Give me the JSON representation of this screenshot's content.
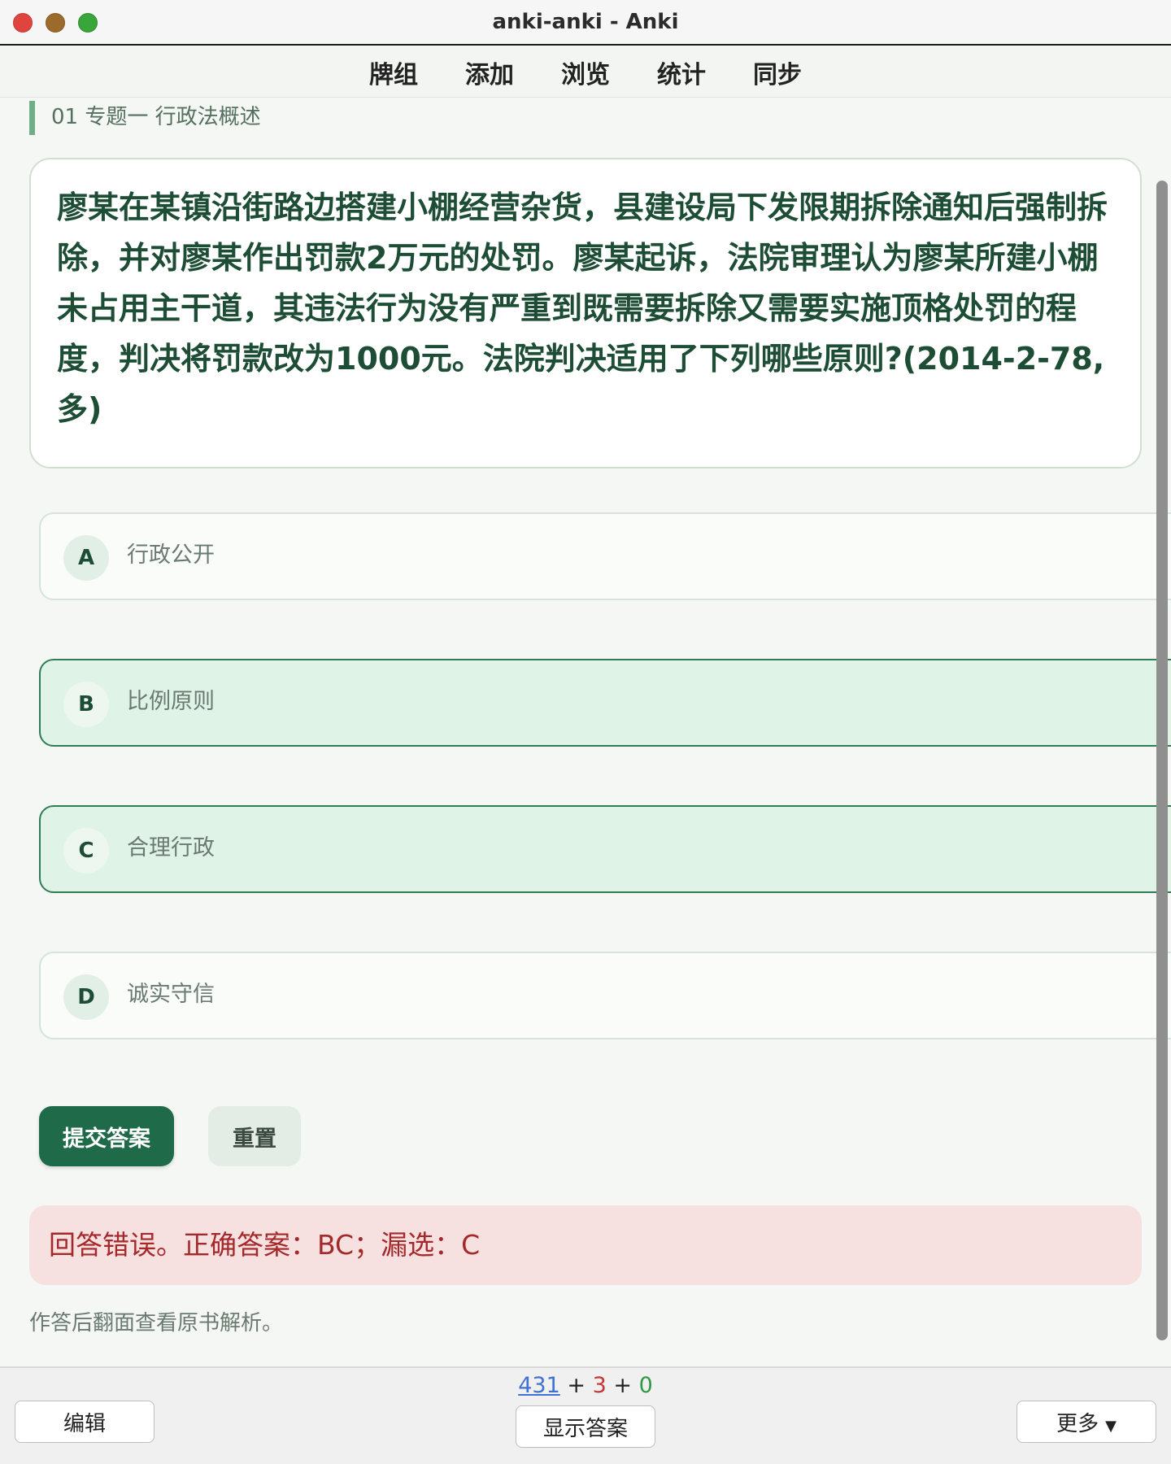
{
  "window": {
    "title": "anki-anki - Anki"
  },
  "nav": {
    "items": [
      "牌组",
      "添加",
      "浏览",
      "统计",
      "同步"
    ]
  },
  "card": {
    "deck_path": "01 专题一 行政法概述",
    "question": "廖某在某镇沿街路边搭建小棚经营杂货，县建设局下发限期拆除通知后强制拆除，并对廖某作出罚款2万元的处罚。廖某起诉，法院审理认为廖某所建小棚未占用主干道，其违法行为没有严重到既需要拆除又需要实施顶格处罚的程度，判决将罚款改为1000元。法院判决适用了下列哪些原则?(2014-2-78,多)",
    "options": [
      {
        "letter": "A",
        "text": "行政公开",
        "selected": false
      },
      {
        "letter": "B",
        "text": "比例原则",
        "selected": true
      },
      {
        "letter": "C",
        "text": "合理行政",
        "selected": true
      },
      {
        "letter": "D",
        "text": "诚实守信",
        "selected": false
      }
    ],
    "submit_label": "提交答案",
    "reset_label": "重置",
    "result": "回答错误。正确答案：BC；漏选：C",
    "hint": "作答后翻面查看原书解析。"
  },
  "bottom": {
    "edit_label": "编辑",
    "show_answer_label": "显示答案",
    "more_label": "更多",
    "counts": {
      "new": "431",
      "learn": "3",
      "review": "0",
      "sep": "+"
    }
  },
  "colors": {
    "accent": "#1f6b49",
    "selected_bg": "#dff3e6",
    "error_bg": "#f7e0e0",
    "error_text": "#a5282a"
  }
}
